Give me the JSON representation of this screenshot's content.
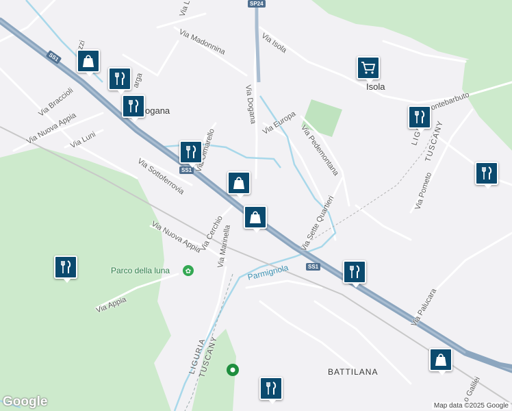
{
  "map": {
    "roads": [
      "Via Madonnina",
      "Via Isola",
      "Via Dogana",
      "Via Europa",
      "Via Pedemontana",
      "Via Braccioli",
      "Via Luni",
      "Via Olmarello",
      "Via Nuova Appia",
      "Via Sottoferrovia",
      "Via Nuova Appia",
      "Via Cerchio",
      "Via Marinella",
      "Via Sette Quartieri",
      "Via Appia",
      "Via Pometo",
      "Via Palucara",
      "ontebarbuto",
      "Via L",
      "ozzi",
      "arga",
      "o Galilei",
      "Parmignola"
    ],
    "places": [
      "Isola",
      "ogana",
      "BATTILANA"
    ],
    "park": "Parco della luna",
    "regions": [
      "LIGURIA",
      "TUSCANY",
      "LIGURIA",
      "TUSCANY"
    ],
    "shields": [
      "SS1",
      "SS1",
      "SS1",
      "SP24"
    ],
    "legal": {
      "logo": "Google",
      "attribution": "Map data ©2025 Google"
    }
  },
  "markers": [
    {
      "type": "shopping",
      "icon": "shopping-bag-icon"
    },
    {
      "type": "restaurant",
      "icon": "restaurant-icon"
    },
    {
      "type": "restaurant",
      "icon": "restaurant-icon"
    },
    {
      "type": "restaurant",
      "icon": "restaurant-icon"
    },
    {
      "type": "shopping",
      "icon": "shopping-bag-icon"
    },
    {
      "type": "shopping",
      "icon": "shopping-bag-icon"
    },
    {
      "type": "supermarket",
      "icon": "shopping-cart-icon"
    },
    {
      "type": "restaurant",
      "icon": "restaurant-icon"
    },
    {
      "type": "restaurant",
      "icon": "restaurant-icon"
    },
    {
      "type": "restaurant",
      "icon": "restaurant-icon"
    },
    {
      "type": "restaurant",
      "icon": "restaurant-icon"
    },
    {
      "type": "shopping",
      "icon": "shopping-bag-icon"
    },
    {
      "type": "restaurant",
      "icon": "restaurant-icon"
    }
  ],
  "colors": {
    "land": "#f2f1f4",
    "park": "#cdeacc",
    "water": "#a8d8ea",
    "highway": "#8ca6bf",
    "marker": "#0b4a6e"
  }
}
